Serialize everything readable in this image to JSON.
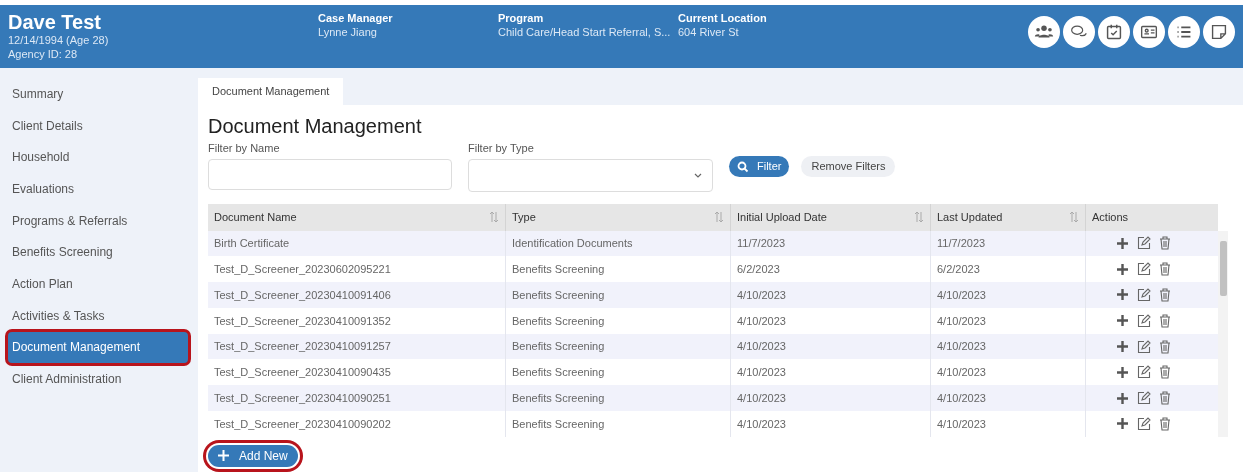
{
  "header": {
    "client_name": "Dave Test",
    "dob": "12/14/1994 (Age 28)",
    "agency_id": "Agency ID: 28",
    "fields": [
      {
        "label": "Case Manager",
        "value": "Lynne Jiang"
      },
      {
        "label": "Program",
        "value": "Child Care/Head Start Referral, S..."
      },
      {
        "label": "Current Location",
        "value": "604 River St"
      }
    ],
    "icons": [
      {
        "kind": "people"
      },
      {
        "kind": "chat"
      },
      {
        "kind": "calendar"
      },
      {
        "kind": "id-card"
      },
      {
        "kind": "list"
      },
      {
        "kind": "note"
      }
    ]
  },
  "sidebar": {
    "items": [
      {
        "label": "Summary",
        "selected": false,
        "highlighted": false
      },
      {
        "label": "Client Details",
        "selected": false,
        "highlighted": false
      },
      {
        "label": "Household",
        "selected": false,
        "highlighted": false
      },
      {
        "label": "Evaluations",
        "selected": false,
        "highlighted": false
      },
      {
        "label": "Programs & Referrals",
        "selected": false,
        "highlighted": false
      },
      {
        "label": "Benefits Screening",
        "selected": false,
        "highlighted": false
      },
      {
        "label": "Action Plan",
        "selected": false,
        "highlighted": false
      },
      {
        "label": "Activities & Tasks",
        "selected": false,
        "highlighted": false
      },
      {
        "label": "Document Management",
        "selected": true,
        "highlighted": true
      },
      {
        "label": "Client Administration",
        "selected": false,
        "highlighted": false
      }
    ]
  },
  "tabs": [
    {
      "label": "Document Management",
      "selected": true
    }
  ],
  "page_title": "Document Management",
  "filters": {
    "name_label": "Filter by Name",
    "type_label": "Filter by Type",
    "filter_button": "Filter",
    "remove_button": "Remove Filters"
  },
  "table": {
    "columns": [
      {
        "label": "Document Name",
        "sortable": true
      },
      {
        "label": "Type",
        "sortable": true
      },
      {
        "label": "Initial Upload Date",
        "sortable": true
      },
      {
        "label": "Last Updated",
        "sortable": true
      },
      {
        "label": "Actions",
        "sortable": false
      }
    ],
    "rows": [
      [
        "Birth Certificate",
        "Identification Documents",
        "11/7/2023",
        "11/7/2023"
      ],
      [
        "Test_D_Screener_20230602095221",
        "Benefits Screening",
        "6/2/2023",
        "6/2/2023"
      ],
      [
        "Test_D_Screener_20230410091406",
        "Benefits Screening",
        "4/10/2023",
        "4/10/2023"
      ],
      [
        "Test_D_Screener_20230410091352",
        "Benefits Screening",
        "4/10/2023",
        "4/10/2023"
      ],
      [
        "Test_D_Screener_20230410091257",
        "Benefits Screening",
        "4/10/2023",
        "4/10/2023"
      ],
      [
        "Test_D_Screener_20230410090435",
        "Benefits Screening",
        "4/10/2023",
        "4/10/2023"
      ],
      [
        "Test_D_Screener_20230410090251",
        "Benefits Screening",
        "4/10/2023",
        "4/10/2023"
      ],
      [
        "Test_D_Screener_20230410090202",
        "Benefits Screening",
        "4/10/2023",
        "4/10/2023"
      ]
    ]
  },
  "add_button": {
    "label": "Add New",
    "highlighted": true
  }
}
